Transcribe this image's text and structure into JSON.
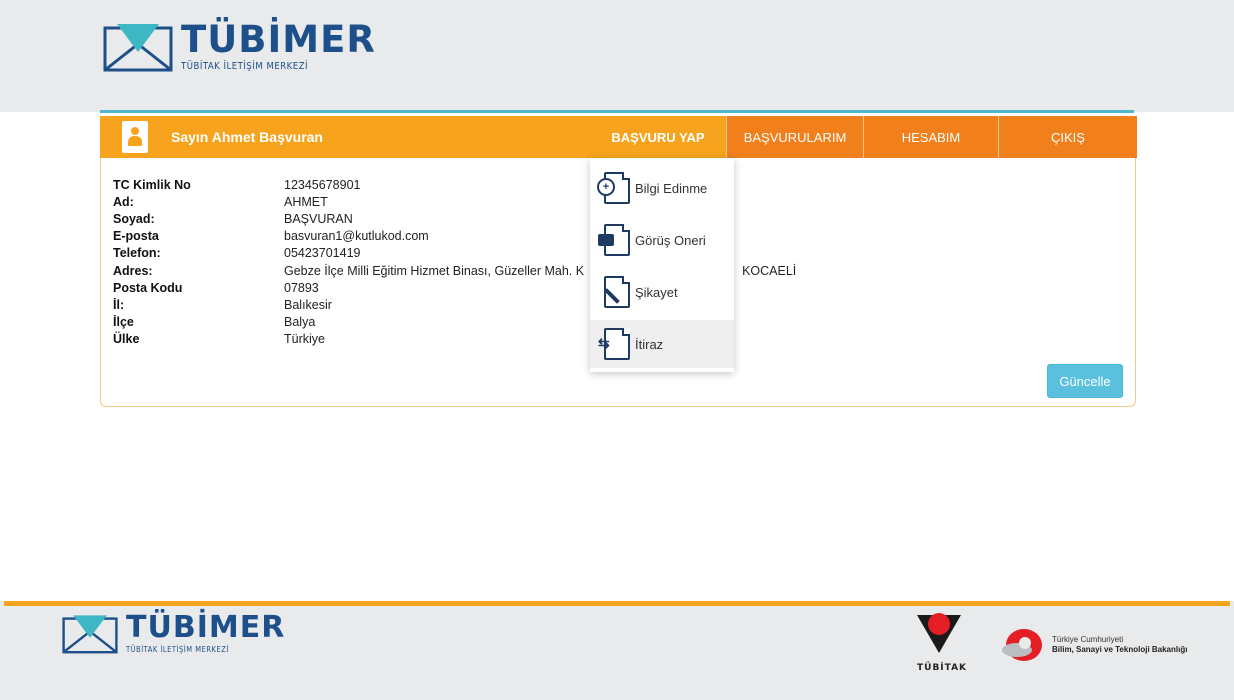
{
  "brand": {
    "name": "TÜBİMER",
    "subtitle": "TÜBİTAK İLETİŞİM MERKEZİ"
  },
  "nav": {
    "greeting": "Sayın Ahmet Başvuran",
    "tabs": [
      {
        "label": "BAŞVURU YAP"
      },
      {
        "label": "BAŞVURULARIM"
      },
      {
        "label": "HESABIM"
      },
      {
        "label": "ÇIKIŞ"
      }
    ]
  },
  "dropdown": {
    "items": [
      {
        "label": "Bilgi Edinme",
        "icon": "document-zoom-icon"
      },
      {
        "label": "Görüş Oneri",
        "icon": "document-comment-icon"
      },
      {
        "label": "Şikayet",
        "icon": "document-pen-icon"
      },
      {
        "label": "İtiraz",
        "icon": "document-arrows-icon"
      }
    ]
  },
  "profile": {
    "rows": [
      {
        "label": "TC Kimlik No",
        "value": "12345678901"
      },
      {
        "label": "Ad:",
        "value": "AHMET"
      },
      {
        "label": "Soyad:",
        "value": "BAŞVURAN"
      },
      {
        "label": "E-posta",
        "value": "basvuran1@kutlukod.com"
      },
      {
        "label": "Telefon:",
        "value": "05423701419"
      },
      {
        "label": "Adres:",
        "value": "Gebze İlçe Milli Eğitim Hizmet Binası, Güzeller Mah. K",
        "tail": "KOCAELİ"
      },
      {
        "label": "Posta Kodu",
        "value": "07893"
      },
      {
        "label": "İl:",
        "value": "Balıkesir"
      },
      {
        "label": "İlçe",
        "value": "Balya"
      },
      {
        "label": "Ülke",
        "value": "Türkiye"
      }
    ],
    "update_label": "Güncelle"
  },
  "footer": {
    "tubitak_text": "TÜBİTAK",
    "ministry_line1": "Türkiye Cumhuriyeti",
    "ministry_line2": "Bilim, Sanayi ve Teknoloji Bakanlığı"
  },
  "colors": {
    "accent_orange": "#f7a31d",
    "tab_orange": "#f07f1c",
    "brand_blue": "#1d4f8a",
    "info_button": "#5bc0de"
  }
}
